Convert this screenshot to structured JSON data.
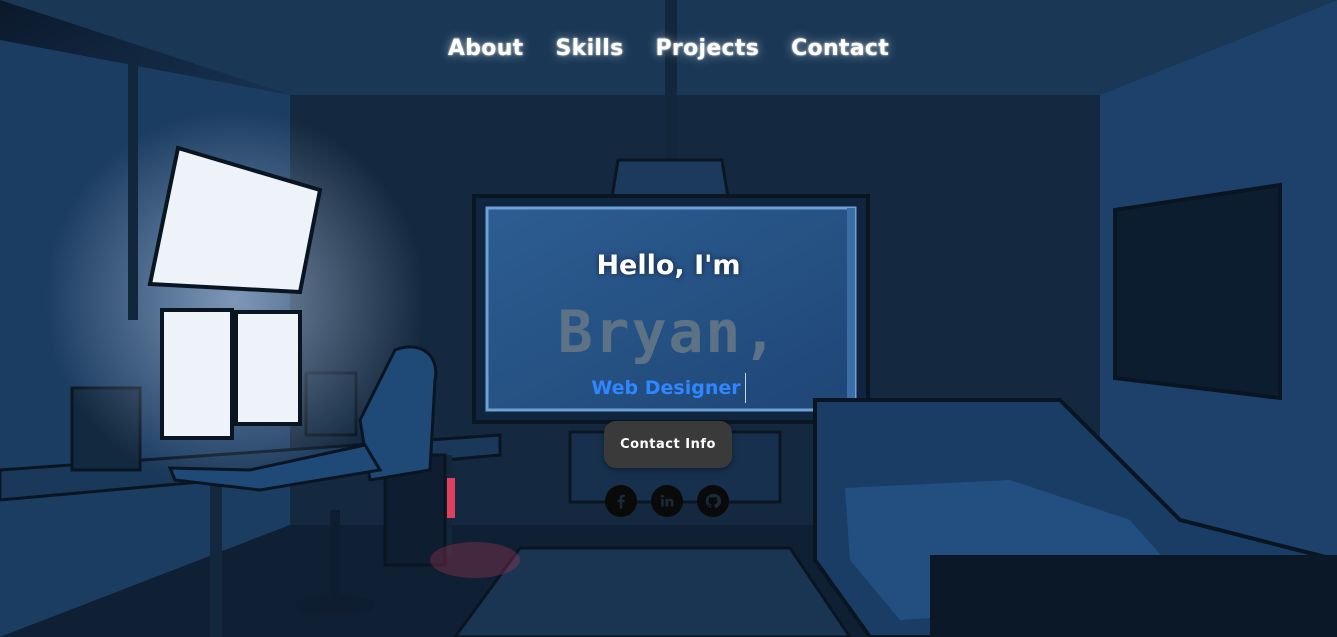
{
  "nav": {
    "items": [
      {
        "label": "About"
      },
      {
        "label": "Skills"
      },
      {
        "label": "Projects"
      },
      {
        "label": "Contact"
      }
    ]
  },
  "hero": {
    "greeting": "Hello, I'm",
    "name": "Bryan,",
    "role": "Web Designer",
    "contact_button": "Contact Info"
  },
  "socials": [
    {
      "icon": "facebook-icon"
    },
    {
      "icon": "linkedin-icon"
    },
    {
      "icon": "github-icon"
    }
  ],
  "colors": {
    "nav_text": "#ffffff",
    "name_text": "#5d7385",
    "role_text": "#2f86ff",
    "button_bg": "#3a3a3a"
  }
}
